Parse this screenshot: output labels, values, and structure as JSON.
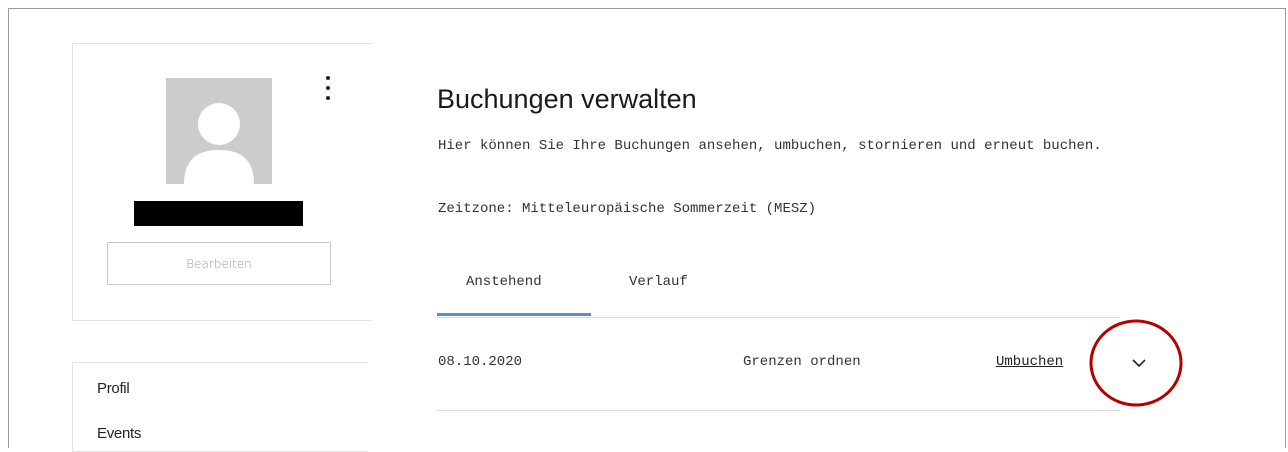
{
  "profile": {
    "edit_label": "Bearbeiten"
  },
  "sidebar": {
    "items": [
      {
        "label": "Profil"
      },
      {
        "label": "Events"
      }
    ]
  },
  "main": {
    "title": "Buchungen verwalten",
    "description": "Hier können Sie Ihre Buchungen ansehen, umbuchen, stornieren und erneut buchen.",
    "timezone": "Zeitzone: Mitteleuropäische Sommerzeit (MESZ)",
    "tabs": [
      {
        "label": "Anstehend",
        "active": true
      },
      {
        "label": "Verlauf",
        "active": false
      }
    ],
    "bookings": [
      {
        "date": "08.10.2020",
        "title": "Grenzen ordnen",
        "action": "Umbuchen"
      }
    ]
  },
  "colors": {
    "accent": "#5b8fd8",
    "annotation": "#b30000",
    "avatar_bg": "#cccccc"
  },
  "icons": [
    "more-vertical-icon",
    "avatar-placeholder-icon",
    "chevron-down-icon"
  ]
}
